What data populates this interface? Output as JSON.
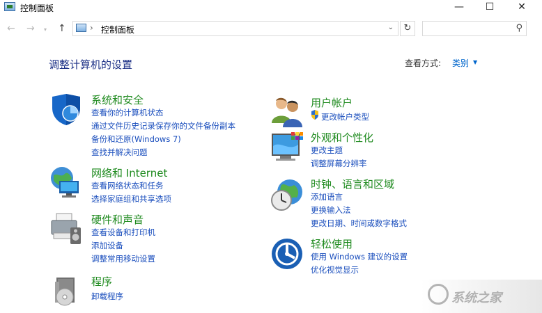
{
  "window": {
    "title": "控制面板",
    "minimize": "—",
    "maximize": "☐",
    "close": "✕"
  },
  "nav": {
    "back": "←",
    "forward": "→",
    "dropdown": "▾",
    "up": "↑",
    "breadcrumb_sep": "›",
    "address": "控制面板",
    "address_dropdown": "⌄",
    "refresh": "↻",
    "search_placeholder": "",
    "search_glyph": "⚲"
  },
  "header": {
    "title": "调整计算机的设置",
    "view_by_label": "查看方式:",
    "view_by_value": "类别",
    "view_by_arrow": "▼"
  },
  "categories_left": [
    {
      "title": "系统和安全",
      "icon": "shield-icon",
      "links": [
        "查看你的计算机状态",
        "通过文件历史记录保存你的文件备份副本",
        "备份和还原(Windows 7)",
        "查找并解决问题"
      ]
    },
    {
      "title": "网络和 Internet",
      "icon": "network-icon",
      "links": [
        "查看网络状态和任务",
        "选择家庭组和共享选项"
      ]
    },
    {
      "title": "硬件和声音",
      "icon": "printer-icon",
      "links": [
        "查看设备和打印机",
        "添加设备",
        "调整常用移动设置"
      ]
    },
    {
      "title": "程序",
      "icon": "programs-icon",
      "links": [
        "卸载程序"
      ]
    }
  ],
  "categories_right": [
    {
      "title": "用户帐户",
      "icon": "users-icon",
      "links": [
        "更改帐户类型"
      ]
    },
    {
      "title": "外观和个性化",
      "icon": "monitor-icon",
      "links": [
        "更改主题",
        "调整屏幕分辨率"
      ]
    },
    {
      "title": "时钟、语言和区域",
      "icon": "clock-globe-icon",
      "links": [
        "添加语言",
        "更换输入法",
        "更改日期、时间或数字格式"
      ]
    },
    {
      "title": "轻松使用",
      "icon": "ease-of-access-icon",
      "links": [
        "使用 Windows 建议的设置",
        "优化视觉显示"
      ]
    }
  ],
  "watermark": {
    "text": "系统之家"
  },
  "colors": {
    "title_green": "#1e8a1e",
    "link_blue": "#1a4ebd",
    "heading_navy": "#1e3287"
  }
}
